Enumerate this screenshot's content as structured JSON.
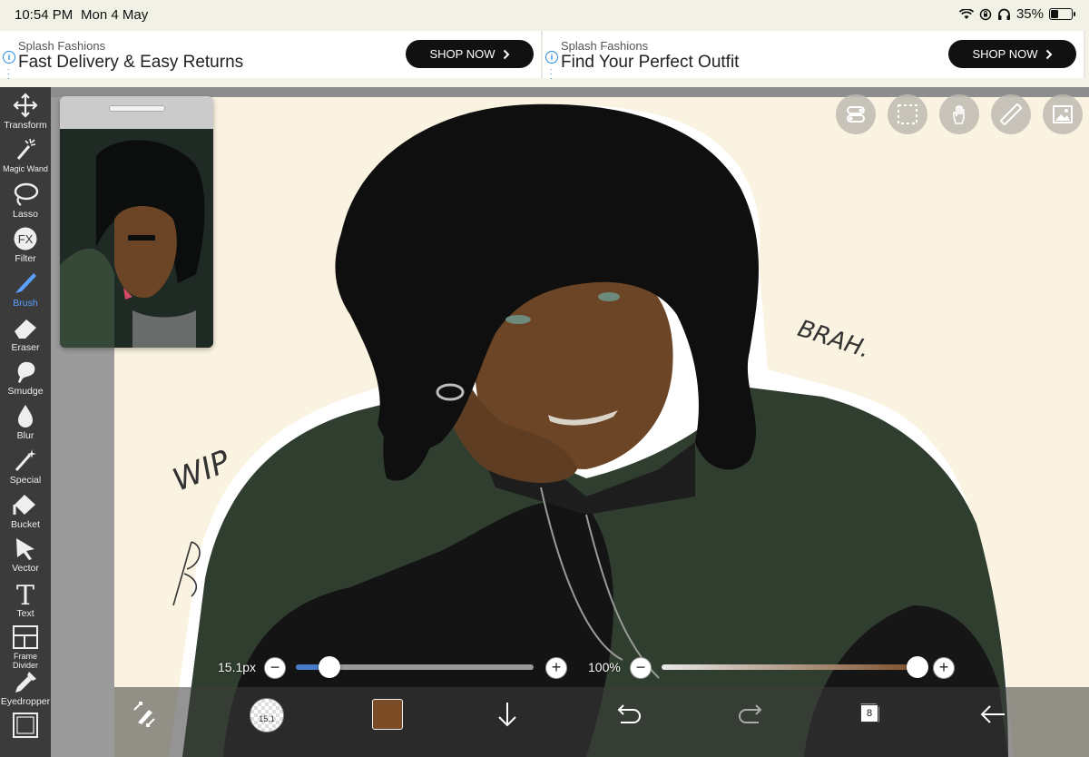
{
  "status_bar": {
    "time": "10:54 PM",
    "date": "Mon 4 May",
    "battery": "35%",
    "battery_level": 0.35
  },
  "ads": [
    {
      "brand": "Splash Fashions",
      "headline": "Fast Delivery & Easy Returns",
      "cta": "SHOP NOW"
    },
    {
      "brand": "Splash Fashions",
      "headline": "Find Your Perfect Outfit",
      "cta": "SHOP NOW"
    }
  ],
  "toolbar": {
    "items": [
      {
        "label": "Transform",
        "icon": "move-arrows-icon"
      },
      {
        "label": "Magic Wand",
        "icon": "magic-wand-icon"
      },
      {
        "label": "Lasso",
        "icon": "lasso-icon"
      },
      {
        "label": "Filter",
        "icon": "fx-icon"
      },
      {
        "label": "Brush",
        "icon": "brush-icon",
        "active": true
      },
      {
        "label": "Eraser",
        "icon": "eraser-icon"
      },
      {
        "label": "Smudge",
        "icon": "smudge-icon"
      },
      {
        "label": "Blur",
        "icon": "drop-icon"
      },
      {
        "label": "Special",
        "icon": "special-wand-icon"
      },
      {
        "label": "Bucket",
        "icon": "bucket-icon"
      },
      {
        "label": "Vector",
        "icon": "cursor-arrow-icon"
      },
      {
        "label": "Text",
        "icon": "text-t-icon"
      },
      {
        "label": "Frame Divider",
        "icon": "frame-divider-icon"
      },
      {
        "label": "Eyedropper",
        "icon": "eyedropper-icon"
      },
      {
        "label": "",
        "icon": "canvas-frame-icon"
      }
    ]
  },
  "canvas": {
    "annotations": [
      "BRAH.",
      "WIP"
    ],
    "accent_color": "#5aa0ff",
    "background": "#fbf3e1"
  },
  "top_tools": [
    {
      "icon": "toggle-switch-icon"
    },
    {
      "icon": "selection-marquee-icon"
    },
    {
      "icon": "hand-touch-icon"
    },
    {
      "icon": "ruler-icon"
    },
    {
      "icon": "image-icon"
    }
  ],
  "sliders": {
    "brush_size": {
      "label": "15.1px",
      "value_fraction": 0.14
    },
    "opacity": {
      "label": "100%",
      "value_fraction": 1.0
    }
  },
  "bottom_bar": {
    "brush_preview_label": "15.1",
    "current_color": "#7a4b25",
    "layer_count": "8",
    "icons": [
      "swap-brush-icon",
      "brush-preview-icon",
      "color-swatch",
      "download-arrow-icon",
      "undo-icon",
      "redo-icon",
      "layers-icon",
      "back-arrow-icon"
    ]
  }
}
